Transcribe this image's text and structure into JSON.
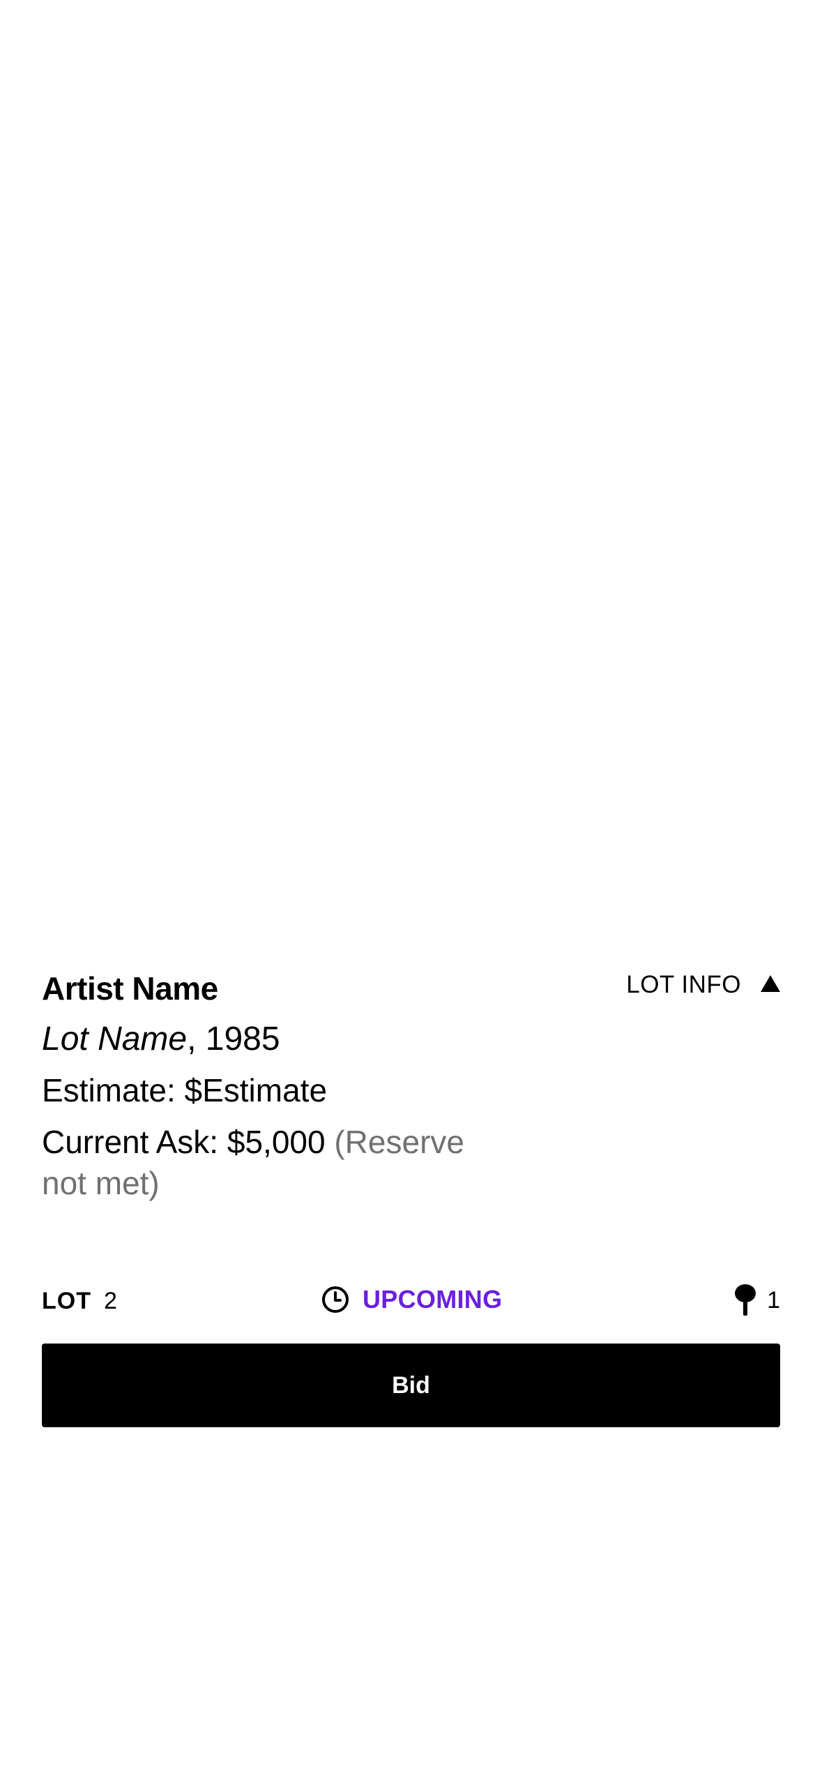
{
  "lot": {
    "artist_name": "Artist Name",
    "lot_name": "Lot Name",
    "year_suffix": ", 1985",
    "estimate": "Estimate: $Estimate",
    "current_ask": "Current Ask: $5,000",
    "reserve_status": "(Reserve not met)",
    "lot_info_label": "LOT INFO",
    "lot_info_icon": "triangle-up-icon"
  },
  "status_row": {
    "lot_label": "LOT",
    "lot_number": "2",
    "status_icon": "clock-icon",
    "status_label": "UPCOMING",
    "bid_icon": "paddle-icon",
    "bid_count": "1"
  },
  "actions": {
    "bid_label": "Bid"
  },
  "colors": {
    "status_accent": "#6b1fe0",
    "button_background": "#000000",
    "reserve_text": "#707070"
  }
}
